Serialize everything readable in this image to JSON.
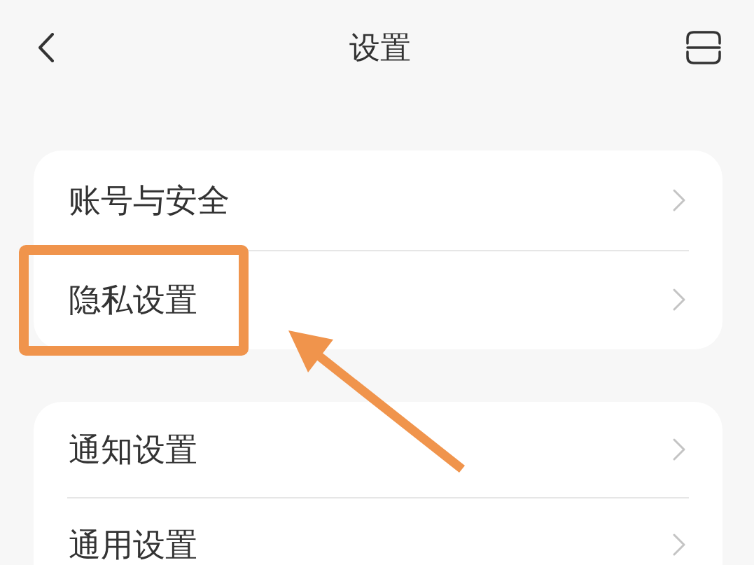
{
  "header": {
    "title": "设置"
  },
  "groups": [
    {
      "items": [
        {
          "label": "账号与安全",
          "highlighted": false
        },
        {
          "label": "隐私设置",
          "highlighted": true
        }
      ]
    },
    {
      "items": [
        {
          "label": "通知设置",
          "highlighted": false
        },
        {
          "label": "通用设置",
          "highlighted": false
        }
      ]
    }
  ]
}
